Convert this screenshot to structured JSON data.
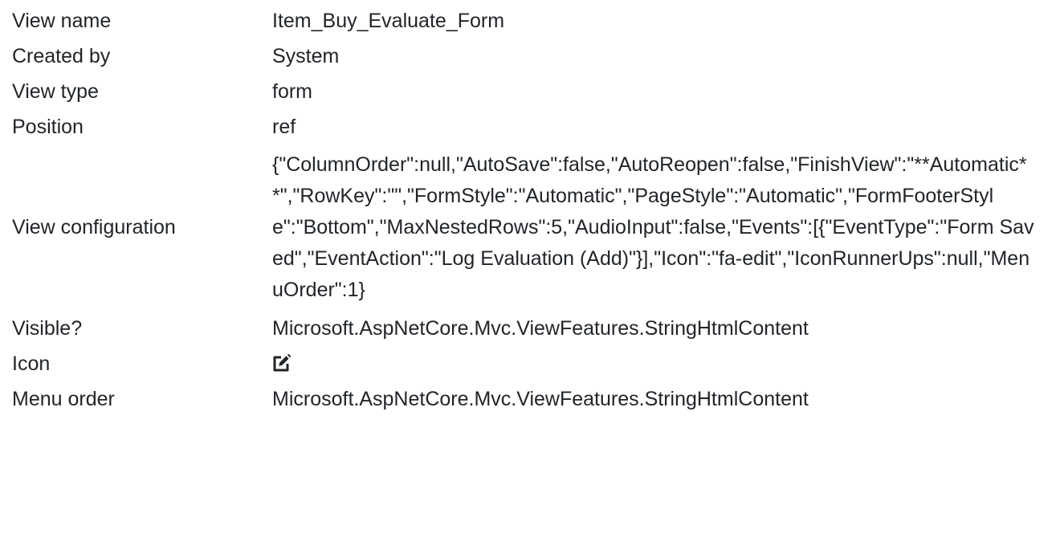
{
  "rows": [
    {
      "label": "View name",
      "value": "Item_Buy_Evaluate_Form"
    },
    {
      "label": "Created by",
      "value": "System"
    },
    {
      "label": "View type",
      "value": "form"
    },
    {
      "label": "Position",
      "value": "ref"
    },
    {
      "label": "View configuration",
      "value": "{\"ColumnOrder\":null,\"AutoSave\":false,\"AutoReopen\":false,\"FinishView\":\"**Automatic**\",\"RowKey\":\"\",\"FormStyle\":\"Automatic\",\"PageStyle\":\"Automatic\",\"FormFooterStyle\":\"Bottom\",\"MaxNestedRows\":5,\"AudioInput\":false,\"Events\":[{\"EventType\":\"Form Saved\",\"EventAction\":\"Log Evaluation (Add)\"}],\"Icon\":\"fa-edit\",\"IconRunnerUps\":null,\"MenuOrder\":1}"
    },
    {
      "label": "Visible?",
      "value": "Microsoft.AspNetCore.Mvc.ViewFeatures.StringHtmlContent"
    },
    {
      "label": "Icon",
      "icon": "edit-icon"
    },
    {
      "label": "Menu order",
      "value": "Microsoft.AspNetCore.Mvc.ViewFeatures.StringHtmlContent"
    }
  ]
}
